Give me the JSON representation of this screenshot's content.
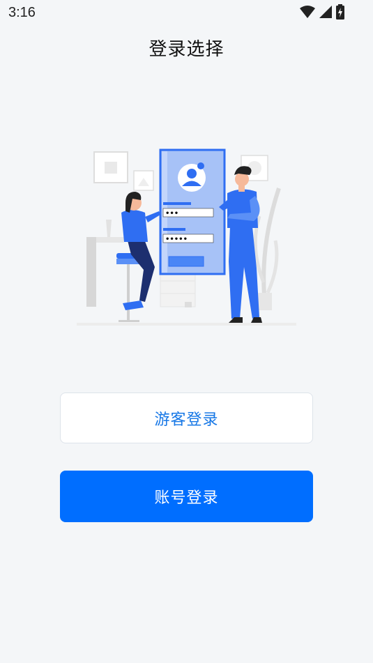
{
  "status_bar": {
    "time": "3:16",
    "icons": [
      "wifi-icon",
      "cellular-signal-icon",
      "battery-charging-icon"
    ]
  },
  "header": {
    "title": "登录选择"
  },
  "illustration": {
    "password_dots_1": "•••",
    "password_dots_2": "•••••"
  },
  "actions": {
    "guest_login_label": "游客登录",
    "account_login_label": "账号登录"
  },
  "colors": {
    "primary": "#006eff",
    "guest_text": "#1677e6",
    "background": "#f4f6f8"
  }
}
